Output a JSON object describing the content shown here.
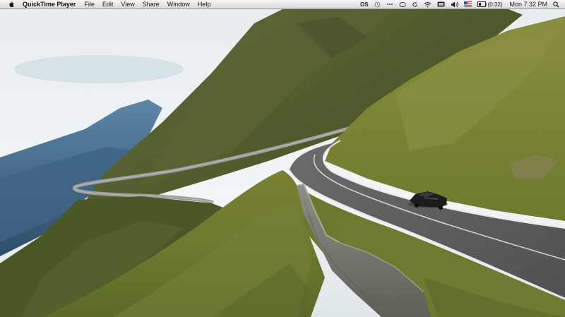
{
  "menubar": {
    "apple_icon": "apple-logo-icon",
    "app_name": "QuickTime Player",
    "menus": [
      "File",
      "Edit",
      "View",
      "Share",
      "Window",
      "Help"
    ],
    "status": {
      "input_label": "OS",
      "battery_text": "(0:32)",
      "clock": "Mon 7:32 PM",
      "icons": [
        "os-extra-icon",
        "time-machine-icon",
        "dots-icon",
        "sync-icon",
        "refresh-icon",
        "wifi-icon",
        "display-icon",
        "volume-icon",
        "us-flag-icon",
        "battery-icon",
        "spotlight-search-icon"
      ]
    }
  },
  "video": {
    "scene": "mountain-road-with-car",
    "colors": {
      "sky": "#eef2f4",
      "grass": "#6d7a2f",
      "road": "#5b5d5f",
      "mountains": "#3d5f7c"
    }
  }
}
